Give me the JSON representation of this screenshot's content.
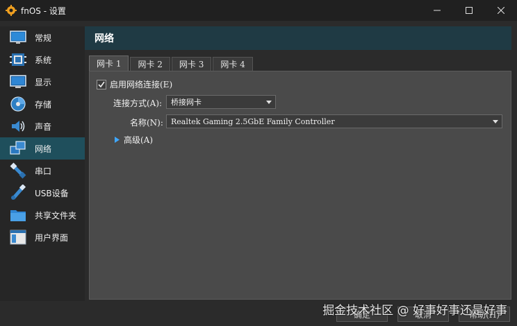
{
  "window": {
    "title": "fnOS - 设置"
  },
  "sidebar": {
    "items": [
      {
        "label": "常规",
        "icon": "general-icon",
        "selected": false
      },
      {
        "label": "系统",
        "icon": "system-icon",
        "selected": false
      },
      {
        "label": "显示",
        "icon": "display-icon",
        "selected": false
      },
      {
        "label": "存储",
        "icon": "storage-icon",
        "selected": false
      },
      {
        "label": "声音",
        "icon": "audio-icon",
        "selected": false
      },
      {
        "label": "网络",
        "icon": "network-icon",
        "selected": true
      },
      {
        "label": "串口",
        "icon": "serial-port-icon",
        "selected": false
      },
      {
        "label": "USB设备",
        "icon": "usb-icon",
        "selected": false
      },
      {
        "label": "共享文件夹",
        "icon": "shared-folder-icon",
        "selected": false
      },
      {
        "label": "用户界面",
        "icon": "user-interface-icon",
        "selected": false
      }
    ]
  },
  "main": {
    "header_title": "网络",
    "tabs": [
      {
        "label": "网卡 1",
        "active": true
      },
      {
        "label": "网卡 2",
        "active": false
      },
      {
        "label": "网卡 3",
        "active": false
      },
      {
        "label": "网卡 4",
        "active": false
      }
    ],
    "enable_adapter": {
      "label": "启用网络连接(E)",
      "checked": true
    },
    "attached_to": {
      "label": "连接方式(A):",
      "value": "桥接网卡"
    },
    "name": {
      "label": "名称(N):",
      "value": "Realtek Gaming 2.5GbE Family Controller"
    },
    "advanced": {
      "label": "高级(A)"
    }
  },
  "buttons": {
    "ok": "确定",
    "cancel": "取消",
    "help": "帮助(H)"
  },
  "watermark": "掘金技术社区 @ 好事好事还是好事",
  "colors": {
    "selected_bg": "#1f4f5c",
    "header_bg": "#1f3a44",
    "panel_bg": "#4a4a4a",
    "accent_arrow": "#3fa7ff"
  }
}
